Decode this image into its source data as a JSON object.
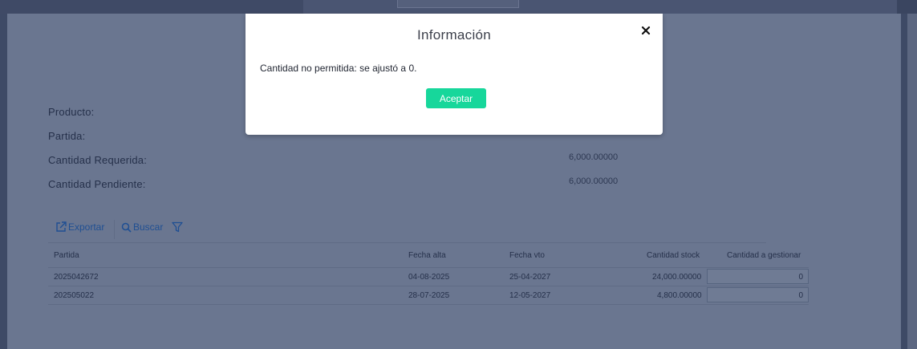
{
  "top_tabs": [
    "",
    ""
  ],
  "fields": [
    {
      "label": "Producto:",
      "value": ""
    },
    {
      "label": "Partida:",
      "value": ""
    },
    {
      "label": "Cantidad Requerida:",
      "value": "6,000.00000"
    },
    {
      "label": "Cantidad Pendiente:",
      "value": "6,000.00000"
    }
  ],
  "toolbar": {
    "export_label": "Exportar",
    "search_label": "Buscar"
  },
  "grid": {
    "columns": [
      "Partida",
      "Fecha alta",
      "Fecha vto",
      "Cantidad stock",
      "Cantidad a gestionar"
    ],
    "rows": [
      {
        "partida": "2025042672",
        "fecha_alta": "04-08-2025",
        "fecha_vto": "25-04-2027",
        "stock": "24,000.00000",
        "gestionar": "0"
      },
      {
        "partida": "202505022",
        "fecha_alta": "28-07-2025",
        "fecha_vto": "12-05-2027",
        "stock": "4,800.00000",
        "gestionar": "0"
      }
    ]
  },
  "modal": {
    "title": "Información",
    "message": "Cantidad no permitida: se ajustó a 0.",
    "accept_label": "Aceptar"
  },
  "colors": {
    "accent_button": "#17d79b",
    "link_blue": "#1f4f93",
    "overlay_bg": "#3e4a66"
  }
}
